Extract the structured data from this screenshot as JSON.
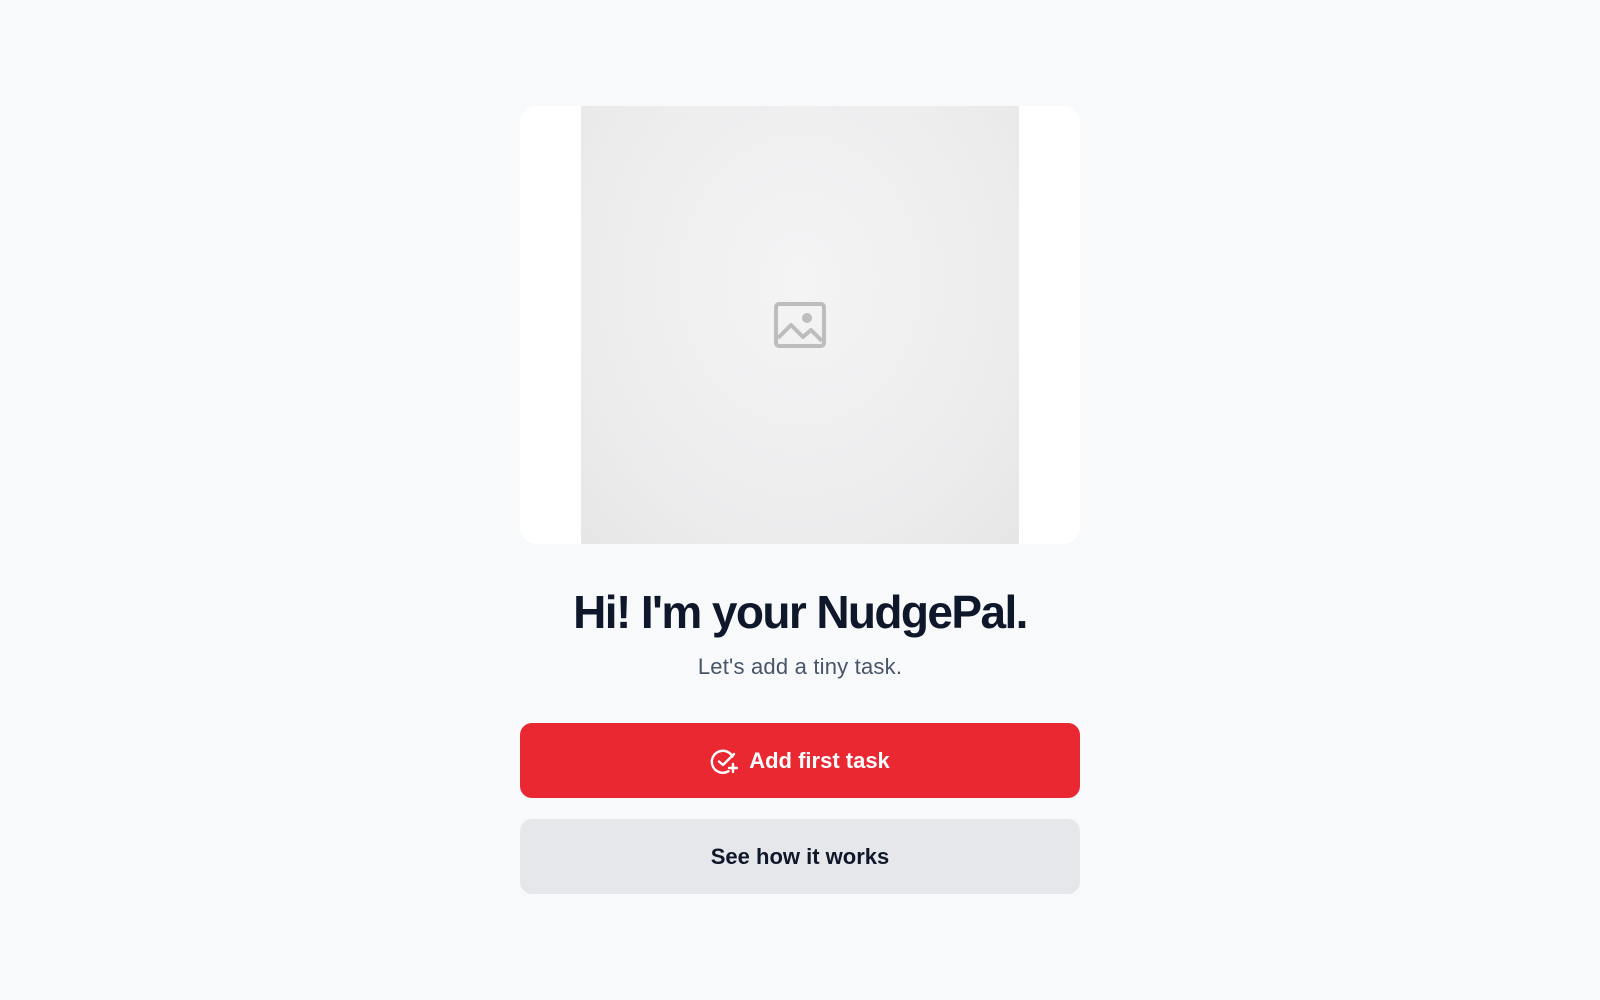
{
  "hero": {
    "image_icon": "image-placeholder-icon"
  },
  "welcome": {
    "headline": "Hi! I'm your NudgePal.",
    "subtitle": "Let's add a tiny task."
  },
  "actions": {
    "primary": {
      "label": "Add first task",
      "icon": "check-circle-plus-icon"
    },
    "secondary": {
      "label": "See how it works"
    }
  },
  "colors": {
    "background": "#f8f9fb",
    "primary": "#e92832",
    "secondary": "#e5e7eb",
    "text": "#0f172a",
    "muted_text": "#475569"
  }
}
